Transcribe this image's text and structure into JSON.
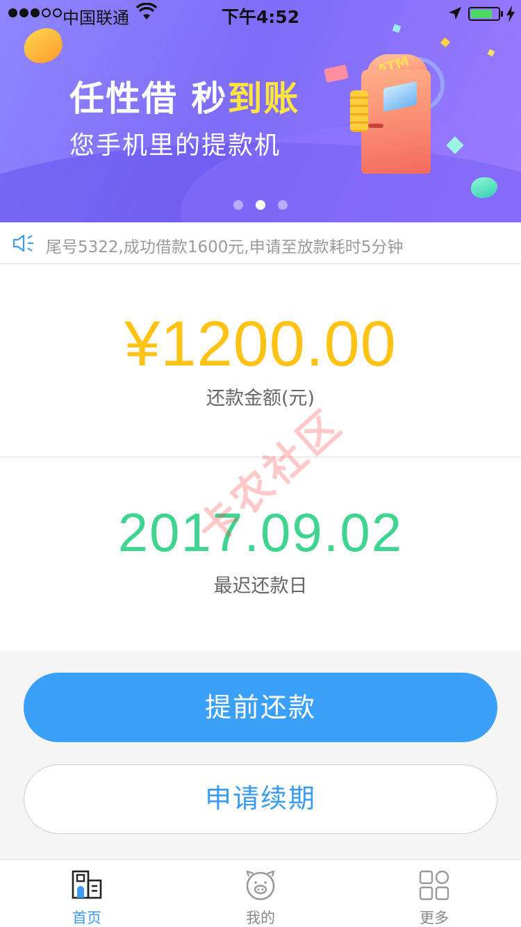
{
  "status_bar": {
    "carrier": "中国联通",
    "time": "下午4:52"
  },
  "banner": {
    "title_part1": "任性借 秒",
    "title_highlight": "到账",
    "subtitle": "您手机里的提款机",
    "atm_label": "ATM",
    "slide_count": 3,
    "active_slide": 2
  },
  "notice": {
    "text": "尾号5322,成功借款1600元,申请至放款耗时5分钟"
  },
  "repayment": {
    "amount": "¥1200.00",
    "amount_label": "还款金额(元)",
    "due_date": "2017.09.02",
    "due_date_label": "最迟还款日"
  },
  "actions": {
    "prepay_label": "提前还款",
    "extend_label": "申请续期"
  },
  "tabbar": {
    "items": [
      {
        "label": "首页",
        "icon": "home-building-icon",
        "active": true
      },
      {
        "label": "我的",
        "icon": "piggy-icon",
        "active": false
      },
      {
        "label": "更多",
        "icon": "grid-icon",
        "active": false
      }
    ]
  },
  "watermark": "卡农社区",
  "colors": {
    "accent_blue": "#3aa0f9",
    "amount_yellow": "#ffc215",
    "date_green": "#3fd48f",
    "banner_purple": "#8f86ff"
  }
}
